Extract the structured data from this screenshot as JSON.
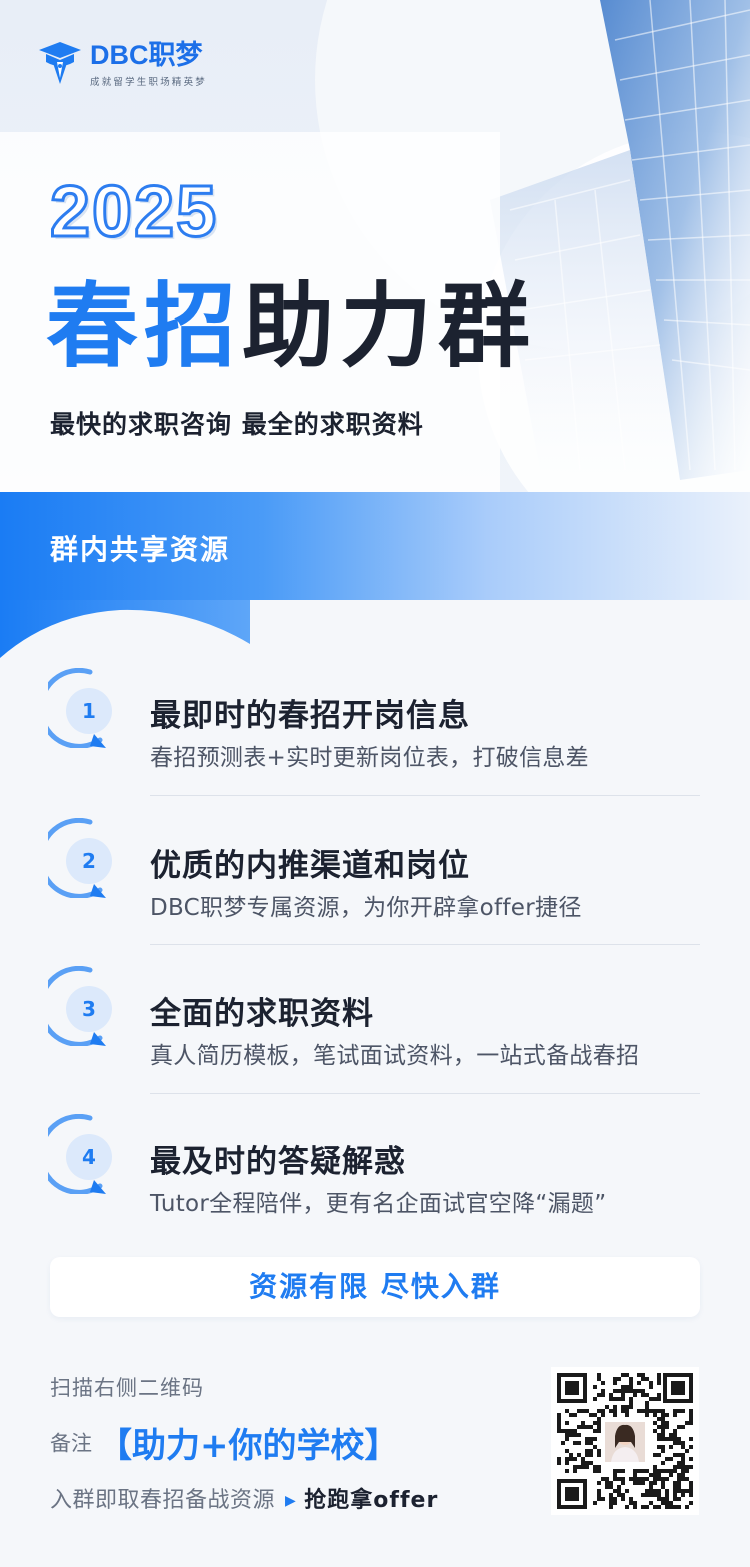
{
  "brand": {
    "name": "DBC职梦",
    "slogan": "成就留学生职场精英梦"
  },
  "hero": {
    "year": "2025",
    "headline_blue": "春招",
    "headline_dark": "助力群",
    "subline": "最快的求职咨询 最全的求职资料"
  },
  "section": {
    "title": "群内共享资源"
  },
  "items": [
    {
      "num": "1",
      "title": "最即时的春招开岗信息",
      "desc": "春招预测表+实时更新岗位表，打破信息差"
    },
    {
      "num": "2",
      "title": "优质的内推渠道和岗位",
      "desc": "DBC职梦专属资源，为你开辟拿offer捷径"
    },
    {
      "num": "3",
      "title": "全面的求职资料",
      "desc": "真人简历模板，笔试面试资料，一站式备战春招"
    },
    {
      "num": "4",
      "title": "最及时的答疑解惑",
      "desc": "Tutor全程陪伴，更有名企面试官空降“漏题”"
    }
  ],
  "cta": {
    "label": "资源有限 尽快入群"
  },
  "footer": {
    "scan_hint": "扫描右侧二维码",
    "note_label": "备注",
    "note_value": "【助力+你的学校】",
    "join_text": "入群即取春招备战资源",
    "grab_text": "抢跑拿offer"
  },
  "colors": {
    "brand_blue": "#1f7cf1",
    "dark_text": "#1c2230",
    "muted_text": "#6b7484"
  }
}
